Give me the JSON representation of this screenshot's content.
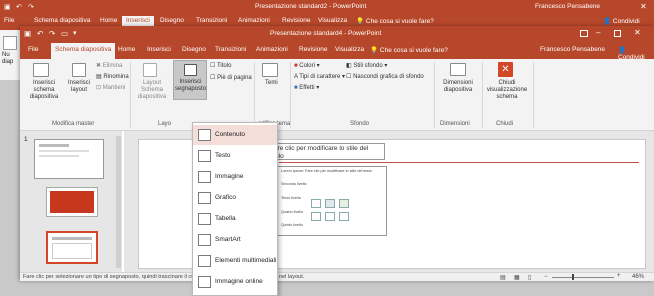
{
  "back_window": {
    "title": "Presentazione standard2 - PowerPoint",
    "user": "Francesco Pensabene",
    "tabs": [
      "File",
      "Schema diapositiva",
      "Home",
      "Inserisci",
      "Disegno",
      "Transizioni",
      "Animazioni",
      "Revisione",
      "Visualizza"
    ],
    "active_tab": "Inserisci",
    "tell_me": "Che cosa si vuole fare?",
    "share": "Condividi",
    "left_label": "Nu\ndiap"
  },
  "front_window": {
    "title": "Presentazione standard4 - PowerPoint",
    "user": "Francesco Pensabene",
    "share": "Condividi",
    "tell_me": "Che cosa si vuole fare?",
    "tabs": [
      "File",
      "Schema diapositiva",
      "Home",
      "Inserisci",
      "Disegno",
      "Transizioni",
      "Animazioni",
      "Revisione",
      "Visualizza"
    ],
    "active_tab": "Schema diapositiva"
  },
  "ribbon": {
    "insert_master": "Inserisci schema diapositiva",
    "insert_layout": "Inserisci layout",
    "delete": "Elimina",
    "rename": "Rinomina",
    "preserve": "Mantieni",
    "group_edit_master": "Modifica master",
    "master_layout": "Layout Schema diapositiva",
    "insert_placeholder": "Inserisci segnaposto",
    "title_chk": "Titolo",
    "footer_chk": "Piè di pagina",
    "group_layout": "Layo",
    "themes": "Temi",
    "group_edit_theme": "odifica tema",
    "colors": "Colori",
    "fonts": "Tipi di carattere",
    "effects": "Effetti",
    "bg_styles": "Stili sfondo",
    "hide_bg": "Nascondi grafica di sfondo",
    "group_background": "Sfondo",
    "slide_size": "Dimensioni diapositiva",
    "group_size": "Dimensioni",
    "close_master": "Chiudi visualizzazione schema",
    "group_close": "Chiudi"
  },
  "placeholder_menu": {
    "items": [
      "Contenuto",
      "Testo",
      "Immagine",
      "Grafico",
      "Tabella",
      "SmartArt",
      "Elementi multimediali",
      "Immagine online"
    ],
    "highlighted": 0
  },
  "thumbnails": {
    "number": "1"
  },
  "slide": {
    "title_placeholder": "Fare clic per modificare lo stile del titolo",
    "content_text": "Lorem ipsum: Fare clic per modificare lo stile del testo",
    "level2": "Secondo livello",
    "level3": "Terzo livello",
    "level4": "Quarto livello",
    "level5": "Quinto livello"
  },
  "status": {
    "message": "Fare clic per selezionare un tipo di segnaposto, quindi trascinare il cursore per disegnare il segnaposto nel layout.",
    "zoom": "46%"
  },
  "colors": {
    "accent": "#b7472a",
    "menu_highlight": "#f3ded9"
  }
}
